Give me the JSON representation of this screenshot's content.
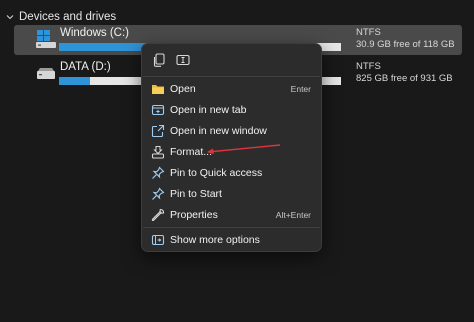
{
  "section": {
    "title": "Devices and drives"
  },
  "drives": [
    {
      "name": "Windows (C:)",
      "fs": "NTFS",
      "free": "30.9 GB free of 118 GB",
      "used_fraction": 0.74
    },
    {
      "name": "DATA (D:)",
      "fs": "NTFS",
      "free": "825 GB free of 931 GB",
      "used_fraction": 0.11
    }
  ],
  "context_menu": {
    "items": [
      {
        "label": "Open",
        "shortcut": "Enter",
        "icon": "folder-icon"
      },
      {
        "label": "Open in new tab",
        "shortcut": "",
        "icon": "new-tab-icon"
      },
      {
        "label": "Open in new window",
        "shortcut": "",
        "icon": "new-window-icon"
      },
      {
        "label": "Format...",
        "shortcut": "",
        "icon": "format-drive-icon"
      },
      {
        "label": "Pin to Quick access",
        "shortcut": "",
        "icon": "pin-icon"
      },
      {
        "label": "Pin to Start",
        "shortcut": "",
        "icon": "pin-icon"
      },
      {
        "label": "Properties",
        "shortcut": "Alt+Enter",
        "icon": "wrench-icon"
      },
      {
        "label": "Show more options",
        "shortcut": "",
        "icon": "more-options-icon"
      }
    ]
  },
  "colors": {
    "background": "#191919",
    "menu_background": "#2c2c2c",
    "accent_bar": "#2f93d7",
    "annotation_arrow": "#e0343c"
  }
}
